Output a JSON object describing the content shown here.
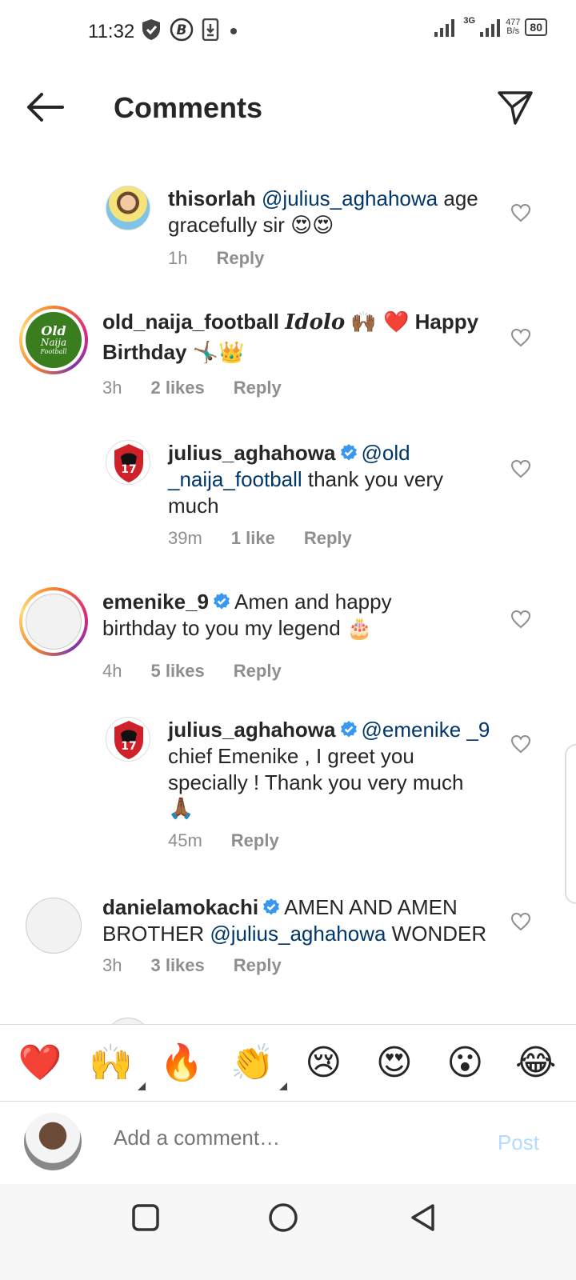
{
  "status_bar": {
    "time": "11:32",
    "network_speed_value": "477",
    "network_speed_unit": "B/s",
    "battery": "80",
    "network_type": "3G"
  },
  "header": {
    "title": "Comments"
  },
  "comments": [
    {
      "username": "thisorlah",
      "mention": "@julius_aghahowa",
      "text": " age gracefully sir ",
      "emoji": "😍😍",
      "time": "1h",
      "reply": "Reply"
    },
    {
      "username": "old_naija_football",
      "text_italic": "Idolo",
      "emoji1": "🙌🏾 ❤️",
      "text_bold": "Happy Birthday",
      "emoji2": "🤸🏾‍♂️👑",
      "time": "3h",
      "likes": "2 likes",
      "reply": "Reply",
      "avatar_text_1": "Old",
      "avatar_text_2": "Naija",
      "avatar_text_3": "Football"
    },
    {
      "username": "julius_aghahowa",
      "mention": "@old _naija_football",
      "text": " thank you very much",
      "time": "39m",
      "likes": "1 like",
      "reply": "Reply",
      "avatar_number": "17"
    },
    {
      "username": "emenike_9",
      "text": "Amen and happy birthday to you my legend ",
      "emoji": "🎂",
      "time": "4h",
      "likes": "5 likes",
      "reply": "Reply"
    },
    {
      "username": "julius_aghahowa",
      "mention": "@emenike _9",
      "text": " chief Emenike , I greet you specially ! Thank you very much",
      "emoji": "🙏🏾",
      "time": "45m",
      "reply": "Reply",
      "avatar_number": "17"
    },
    {
      "username": "danielamokachi",
      "text_pre": "AMEN AND AMEN BROTHER ",
      "mention": "@julius_aghahowa",
      "text_post": " WONDER",
      "time": "3h",
      "likes": "3 likes",
      "reply": "Reply"
    }
  ],
  "reactions": [
    "❤️",
    "🙌",
    "🔥",
    "👏",
    "😢",
    "😍",
    "😮",
    "😂"
  ],
  "add_comment": {
    "placeholder": "Add a comment…",
    "post_label": "Post"
  },
  "colors": {
    "mention": "#00376b",
    "post_disabled": "#b3dbff",
    "verified": "#3897f0",
    "meta": "#8e8e8e"
  }
}
